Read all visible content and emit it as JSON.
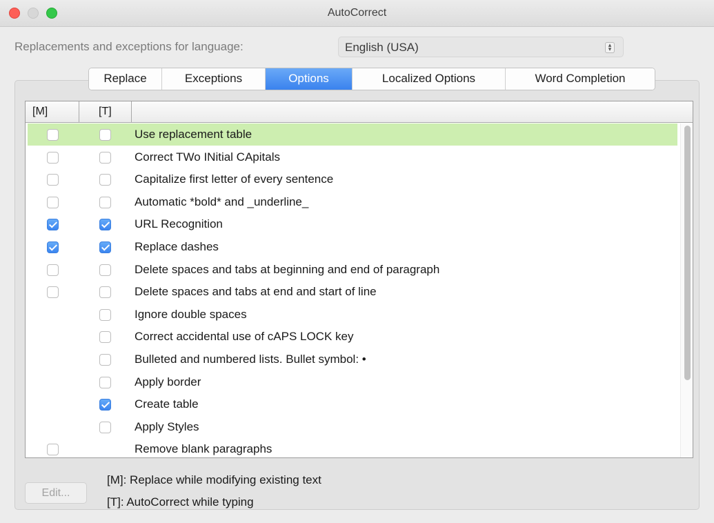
{
  "window": {
    "title": "AutoCorrect"
  },
  "language": {
    "label": "Replacements and exceptions for language:",
    "value": "English (USA)"
  },
  "tabs": [
    {
      "label": "Replace",
      "active": false
    },
    {
      "label": "Exceptions",
      "active": false
    },
    {
      "label": "Options",
      "active": true
    },
    {
      "label": "Localized Options",
      "active": false
    },
    {
      "label": "Word Completion",
      "active": false
    }
  ],
  "columns": [
    "[M]",
    "[T]",
    ""
  ],
  "options": [
    {
      "label": "Use replacement table",
      "m": false,
      "t": false,
      "selected": true
    },
    {
      "label": "Correct TWo INitial CApitals",
      "m": false,
      "t": false
    },
    {
      "label": "Capitalize first letter of every sentence",
      "m": false,
      "t": false
    },
    {
      "label": "Automatic *bold* and _underline_",
      "m": false,
      "t": false
    },
    {
      "label": "URL Recognition",
      "m": true,
      "t": true
    },
    {
      "label": "Replace dashes",
      "m": true,
      "t": true
    },
    {
      "label": "Delete spaces and tabs at beginning and end of paragraph",
      "m": false,
      "t": false
    },
    {
      "label": "Delete spaces and tabs at end and start of line",
      "m": false,
      "t": false
    },
    {
      "label": "Ignore double spaces",
      "m": null,
      "t": false
    },
    {
      "label": "Correct accidental use of cAPS LOCK key",
      "m": null,
      "t": false
    },
    {
      "label": "Bulleted and numbered lists. Bullet symbol: •",
      "m": null,
      "t": false
    },
    {
      "label": "Apply border",
      "m": null,
      "t": false
    },
    {
      "label": "Create table",
      "m": null,
      "t": true
    },
    {
      "label": "Apply Styles",
      "m": null,
      "t": false
    },
    {
      "label": "Remove blank paragraphs",
      "m": false,
      "t": null
    }
  ],
  "footer": {
    "edit_label": "Edit...",
    "legend_m": "[M]: Replace while modifying existing text",
    "legend_t": "[T]: AutoCorrect while typing"
  }
}
